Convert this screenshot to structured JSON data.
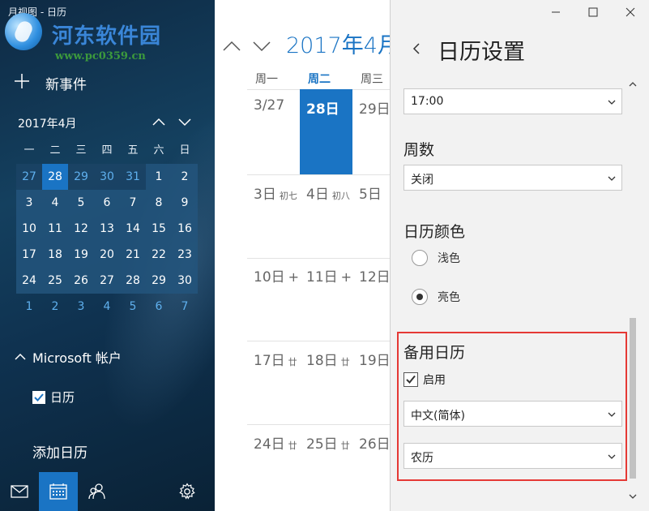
{
  "window": {
    "title": "月视图 - 日历"
  },
  "watermark": {
    "name": "河东软件园",
    "url": "www.pc0359.cn"
  },
  "sidebar": {
    "new_event": "新事件",
    "mini_calendar": {
      "month": "2017年4月",
      "weekday_headers": [
        "一",
        "二",
        "三",
        "四",
        "五",
        "六",
        "日"
      ],
      "weeks": [
        [
          "27",
          "28",
          "29",
          "30",
          "31",
          "1",
          "2"
        ],
        [
          "3",
          "4",
          "5",
          "6",
          "7",
          "8",
          "9"
        ],
        [
          "10",
          "11",
          "12",
          "13",
          "14",
          "15",
          "16"
        ],
        [
          "17",
          "18",
          "19",
          "20",
          "21",
          "22",
          "23"
        ],
        [
          "24",
          "25",
          "26",
          "27",
          "28",
          "29",
          "30"
        ],
        [
          "1",
          "2",
          "3",
          "4",
          "5",
          "6",
          "7"
        ]
      ],
      "selected": "28"
    },
    "account": "Microsoft 帐户",
    "calendar_item": "日历",
    "add_calendar": "添加日历",
    "bottom_icons": [
      "mail-icon",
      "calendar-icon",
      "people-icon",
      "settings-icon"
    ]
  },
  "main": {
    "month": "2017年4月",
    "weekdays": [
      "周一",
      "周二",
      "周三"
    ],
    "weeks": [
      [
        {
          "day": "3/27",
          "lunar": ""
        },
        {
          "day": "28日",
          "lunar": ""
        },
        {
          "day": "29日",
          "lunar": ""
        }
      ],
      [
        {
          "day": "3日",
          "lunar": "初七"
        },
        {
          "day": "4日",
          "lunar": "初八"
        },
        {
          "day": "5日",
          "lunar": ""
        }
      ],
      [
        {
          "day": "10日",
          "lunar": "+"
        },
        {
          "day": "11日",
          "lunar": "+"
        },
        {
          "day": "12日",
          "lunar": ""
        }
      ],
      [
        {
          "day": "17日",
          "lunar": "廿"
        },
        {
          "day": "18日",
          "lunar": "廿"
        },
        {
          "day": "19日",
          "lunar": ""
        }
      ],
      [
        {
          "day": "24日",
          "lunar": "廿"
        },
        {
          "day": "25日",
          "lunar": "廿"
        },
        {
          "day": "26日",
          "lunar": ""
        }
      ]
    ]
  },
  "settings": {
    "title": "日历设置",
    "work_end_time": "17:00",
    "week_numbers": {
      "label": "周数",
      "value": "关闭"
    },
    "color": {
      "label": "日历颜色",
      "options": [
        "浅色",
        "亮色"
      ],
      "selected": "亮色"
    },
    "alt_calendar": {
      "label": "备用日历",
      "enabled_label": "启用",
      "enabled": true,
      "language": "中文(简体)",
      "type": "农历"
    }
  },
  "colors": {
    "accent": "#1a74c4",
    "highlight": "#e53935"
  }
}
